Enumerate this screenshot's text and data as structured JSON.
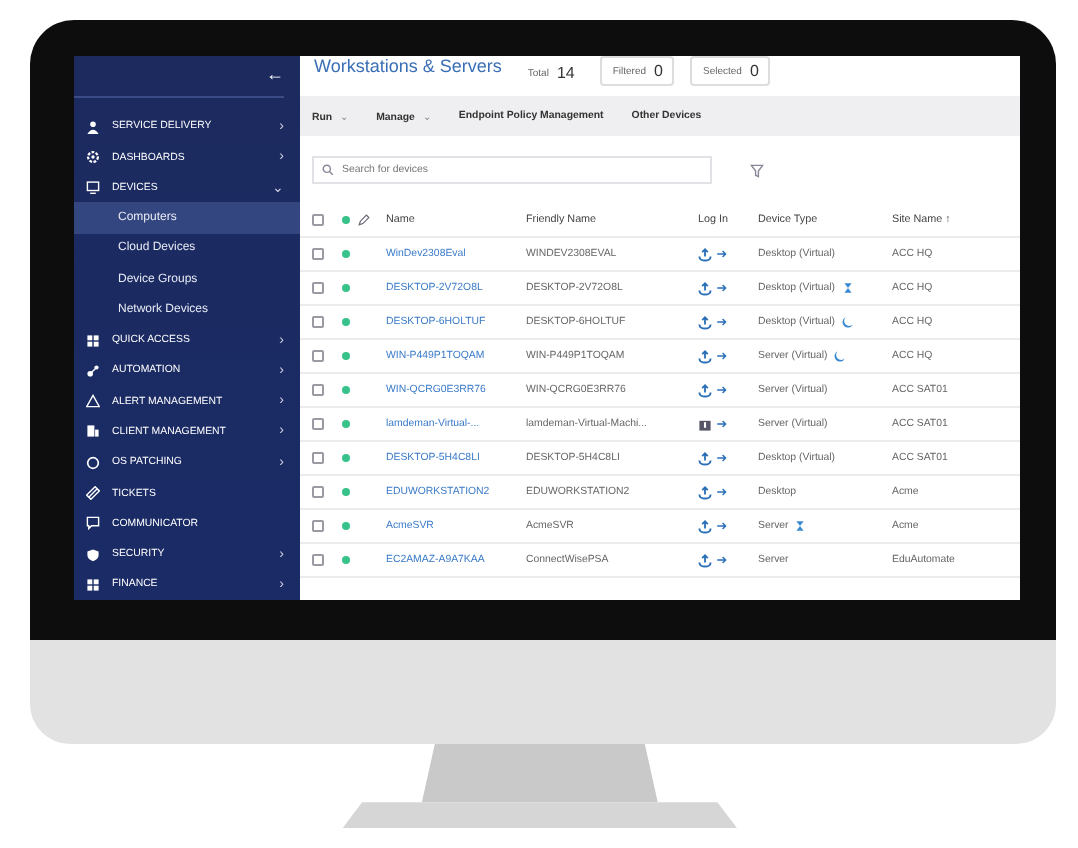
{
  "sidebar": {
    "collapse": "←",
    "items": [
      {
        "label": "SERVICE DELIVERY",
        "chevron": "›",
        "expanded": false
      },
      {
        "label": "DASHBOARDS",
        "chevron": "›",
        "expanded": false
      },
      {
        "label": "DEVICES",
        "chevron": "⌄",
        "expanded": true,
        "children": [
          {
            "label": "Computers",
            "selected": true
          },
          {
            "label": "Cloud Devices",
            "selected": false
          },
          {
            "label": "Device Groups",
            "selected": false
          },
          {
            "label": "Network Devices",
            "selected": false
          }
        ]
      },
      {
        "label": "QUICK ACCESS",
        "chevron": "›",
        "expanded": false
      },
      {
        "label": "AUTOMATION",
        "chevron": "›",
        "expanded": false
      },
      {
        "label": "ALERT MANAGEMENT",
        "chevron": "›",
        "expanded": false
      },
      {
        "label": "CLIENT MANAGEMENT",
        "chevron": "›",
        "expanded": false
      },
      {
        "label": "OS PATCHING",
        "chevron": "›",
        "expanded": false
      },
      {
        "label": "TICKETS",
        "expanded": false
      },
      {
        "label": "COMMUNICATOR",
        "expanded": false
      },
      {
        "label": "SECURITY",
        "chevron": "›",
        "expanded": false
      },
      {
        "label": "FINANCE",
        "chevron": "›",
        "expanded": false
      }
    ]
  },
  "header": {
    "title": "Workstations & Servers",
    "counters": [
      {
        "label": "Total",
        "value": "14",
        "boxed": false
      },
      {
        "label": "Filtered",
        "value": "0",
        "boxed": true
      },
      {
        "label": "Selected",
        "value": "0",
        "boxed": true
      }
    ]
  },
  "toolbar": [
    {
      "label": "Run",
      "caret": "⌄"
    },
    {
      "label": "Manage",
      "caret": "⌄"
    },
    {
      "label": "Endpoint Policy Management"
    },
    {
      "label": "Other Devices"
    }
  ],
  "search": {
    "placeholder": "Search for devices"
  },
  "table": {
    "all_checked": false,
    "columns": [
      "Name",
      "Friendly Name",
      "Log In",
      "Device Type",
      "Site Name ↑"
    ],
    "rows": [
      {
        "name": "WinDev2308Eval",
        "friendly": "WINDEV2308EVAL",
        "agent_alert": false,
        "device_type": "Desktop (Virtual)",
        "pending": false,
        "sleeping": false,
        "site": "ACC HQ",
        "checked": false
      },
      {
        "name": "DESKTOP-2V72O8L",
        "friendly": "DESKTOP-2V72O8L",
        "agent_alert": false,
        "device_type": "Desktop (Virtual)",
        "pending": true,
        "sleeping": false,
        "site": "ACC HQ",
        "checked": false
      },
      {
        "name": "DESKTOP-6HOLTUF",
        "friendly": "DESKTOP-6HOLTUF",
        "agent_alert": false,
        "device_type": "Desktop (Virtual)",
        "pending": false,
        "sleeping": true,
        "site": "ACC HQ",
        "checked": false
      },
      {
        "name": "WIN-P449P1TOQAM",
        "friendly": "WIN-P449P1TOQAM",
        "agent_alert": false,
        "device_type": "Server (Virtual)",
        "pending": false,
        "sleeping": true,
        "site": "ACC HQ",
        "checked": false
      },
      {
        "name": "WIN-QCRG0E3RR76",
        "friendly": "WIN-QCRG0E3RR76",
        "agent_alert": false,
        "device_type": "Server (Virtual)",
        "pending": false,
        "sleeping": false,
        "site": "ACC SAT01",
        "checked": false
      },
      {
        "name": "lamdeman-Virtual-...",
        "friendly": "lamdeman-Virtual-Machi...",
        "agent_alert": true,
        "device_type": "Server (Virtual)",
        "pending": false,
        "sleeping": false,
        "site": "ACC SAT01",
        "checked": false
      },
      {
        "name": "DESKTOP-5H4C8LI",
        "friendly": "DESKTOP-5H4C8LI",
        "agent_alert": false,
        "device_type": "Desktop (Virtual)",
        "pending": false,
        "sleeping": false,
        "site": "ACC SAT01",
        "checked": false
      },
      {
        "name": "EDUWORKSTATION2",
        "friendly": "EDUWORKSTATION2",
        "agent_alert": false,
        "device_type": "Desktop",
        "pending": false,
        "sleeping": false,
        "site": "Acme",
        "checked": false
      },
      {
        "name": "AcmeSVR",
        "friendly": "AcmeSVR",
        "agent_alert": false,
        "device_type": "Server",
        "pending": true,
        "sleeping": false,
        "site": "Acme",
        "checked": false
      },
      {
        "name": "EC2AMAZ-A9A7KAA",
        "friendly": "ConnectWisePSA",
        "agent_alert": false,
        "device_type": "Server",
        "pending": false,
        "sleeping": false,
        "site": "EduAutomate",
        "checked": false
      }
    ]
  }
}
